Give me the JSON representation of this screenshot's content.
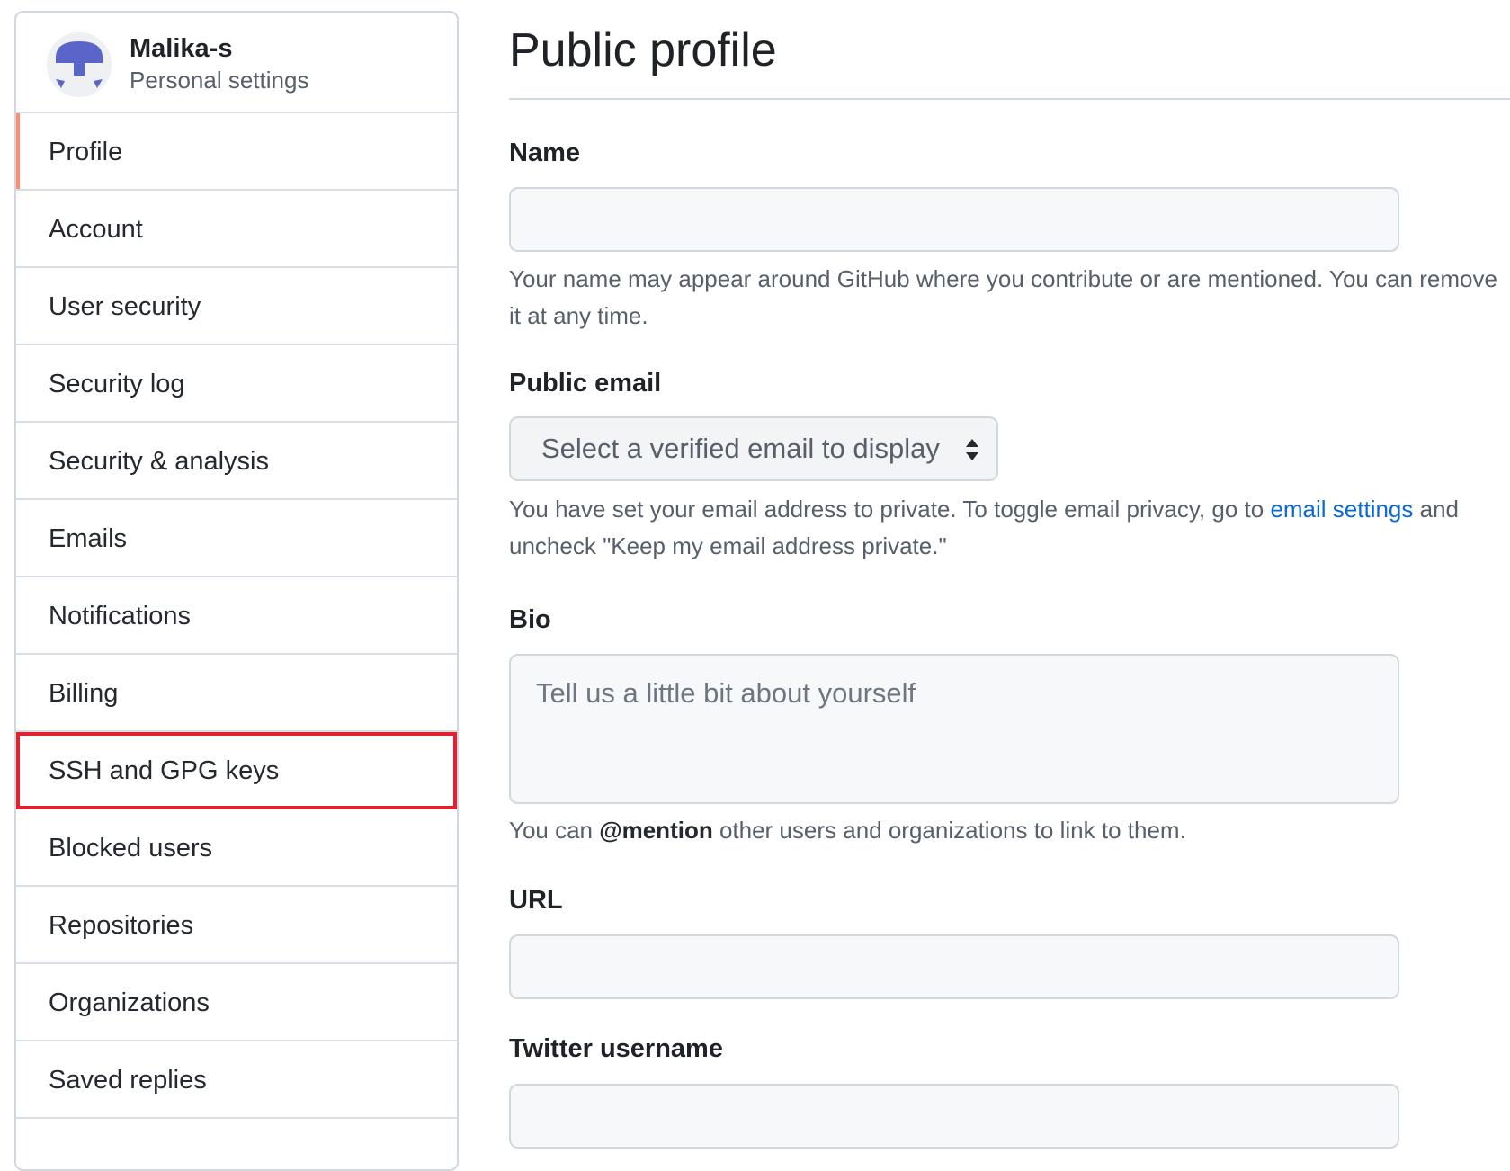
{
  "user": {
    "name": "Malika-s",
    "subtitle": "Personal settings",
    "avatar_icon": "identicon-avatar"
  },
  "sidebar": {
    "items": [
      {
        "label": "Profile",
        "active": true
      },
      {
        "label": "Account"
      },
      {
        "label": "User security"
      },
      {
        "label": "Security log"
      },
      {
        "label": "Security & analysis"
      },
      {
        "label": "Emails"
      },
      {
        "label": "Notifications"
      },
      {
        "label": "Billing"
      },
      {
        "label": "SSH and GPG keys",
        "highlighted": true
      },
      {
        "label": "Blocked users"
      },
      {
        "label": "Repositories"
      },
      {
        "label": "Organizations"
      },
      {
        "label": "Saved replies"
      }
    ]
  },
  "main": {
    "title": "Public profile",
    "name_field": {
      "label": "Name",
      "value": "",
      "note": "Your name may appear around GitHub where you contribute or are mentioned. You can remove it at any time."
    },
    "email_field": {
      "label": "Public email",
      "selected": "Select a verified email to display",
      "note_before": "You have set your email address to private. To toggle email privacy, go to ",
      "note_link": "email settings",
      "note_after": " and uncheck \"Keep my email address private.\""
    },
    "bio_field": {
      "label": "Bio",
      "placeholder": "Tell us a little bit about yourself",
      "note_before": "You can ",
      "note_mention": "@mention",
      "note_after": " other users and organizations to link to them."
    },
    "url_field": {
      "label": "URL",
      "value": ""
    },
    "twitter_field": {
      "label": "Twitter username",
      "value": ""
    }
  },
  "colors": {
    "active_indicator": "#fd8c73",
    "highlight_box": "#e0212e",
    "link": "#0969da",
    "avatar_primary": "#5a65c9"
  }
}
